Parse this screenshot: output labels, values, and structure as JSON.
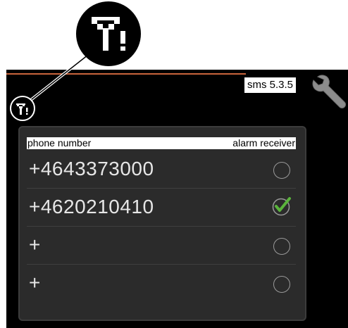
{
  "menu": {
    "title": "sms 5.3.5"
  },
  "icons": {
    "status": "network-warning-icon",
    "settings": "wrench-icon",
    "selected": "checkmark-icon",
    "unselected": "radio-empty-icon"
  },
  "table": {
    "headers": {
      "phone_number": "phone number",
      "alarm_receiver": "alarm receiver"
    },
    "rows": [
      {
        "phone": "+4643373000",
        "alarm_receiver": false
      },
      {
        "phone": "+4620210410",
        "alarm_receiver": true
      },
      {
        "phone": "+",
        "alarm_receiver": false
      },
      {
        "phone": "+",
        "alarm_receiver": false
      }
    ]
  },
  "colors": {
    "accent_line": "#c8643c",
    "checkmark": "#5ab43c",
    "screen_bg": "#000000",
    "panel_bg": "#2b2b2b"
  }
}
